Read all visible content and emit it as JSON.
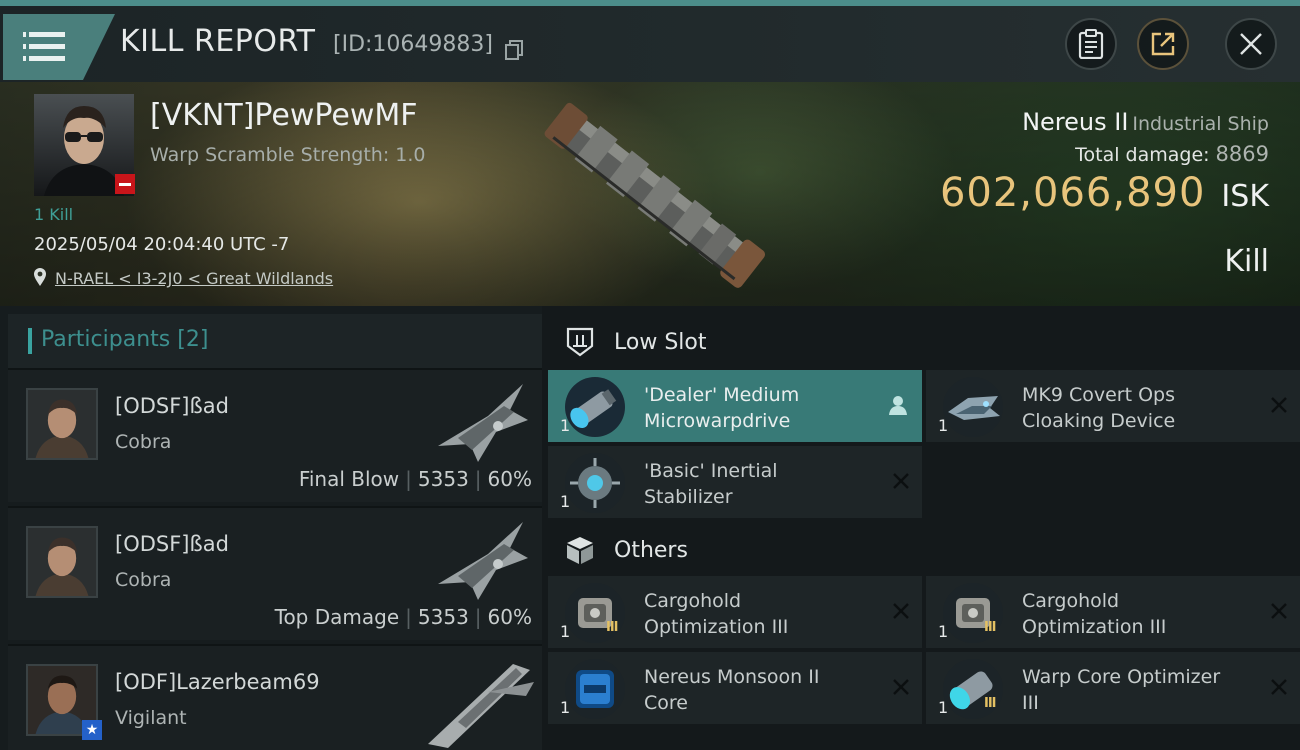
{
  "header": {
    "title": "KILL REPORT",
    "report_id": "[ID:10649883]"
  },
  "victim": {
    "name": "[VKNT]PewPewMF",
    "warp_scramble": "Warp Scramble Strength: 1.0",
    "kills": "1 Kill",
    "datetime": "2025/05/04 20:04:40 UTC -7",
    "location": "N-RAEL < I3-2J0 < Great Wildlands",
    "ship_name": "Nereus II",
    "ship_class": "Industrial Ship",
    "total_damage_label": "Total damage:",
    "total_damage": "8869",
    "isk_value": "602,066,890",
    "isk_unit": "ISK",
    "result": "Kill"
  },
  "participants": {
    "title": "Participants",
    "count": "[2]",
    "rows": [
      {
        "name": "[ODSF]ßad",
        "ship": "Cobra",
        "role": "Final Blow",
        "damage": "5353",
        "percent": "60%"
      },
      {
        "name": "[ODSF]ßad",
        "ship": "Cobra",
        "role": "Top Damage",
        "damage": "5353",
        "percent": "60%"
      },
      {
        "name": "[ODF]Lazerbeam69",
        "ship": "Vigilant"
      }
    ]
  },
  "sections": {
    "low_slot": {
      "title": "Low Slot",
      "items": [
        {
          "name_line1": "'Dealer' Medium",
          "name_line2": "Microwarpdrive",
          "qty": "1"
        },
        {
          "name_line1": "MK9 Covert Ops",
          "name_line2": "Cloaking Device",
          "qty": "1"
        },
        {
          "name_line1": "'Basic' Inertial",
          "name_line2": "Stabilizer",
          "qty": "1"
        }
      ]
    },
    "others": {
      "title": "Others",
      "items": [
        {
          "name_line1": "Cargohold",
          "name_line2": "Optimization III",
          "qty": "1"
        },
        {
          "name_line1": "Cargohold",
          "name_line2": "Optimization III",
          "qty": "1"
        },
        {
          "name_line1": "Nereus Monsoon II",
          "name_line2": "Core",
          "qty": "1"
        },
        {
          "name_line1": "Warp Core Optimizer",
          "name_line2": "III",
          "qty": "1"
        }
      ]
    }
  },
  "colors": {
    "accent_teal": "#3aa3a0",
    "isk_gold": "#e8c47c",
    "active_item": "#387a77",
    "victim_badge_red": "#c8151a",
    "star_badge_blue": "#2461c9"
  },
  "icons": [
    "menu-icon",
    "copy-icon",
    "clipboard-icon",
    "share-icon",
    "close-icon",
    "location-pin-icon",
    "low-slot-icon",
    "cube-icon",
    "remove-x-icon",
    "pilot-icon"
  ]
}
